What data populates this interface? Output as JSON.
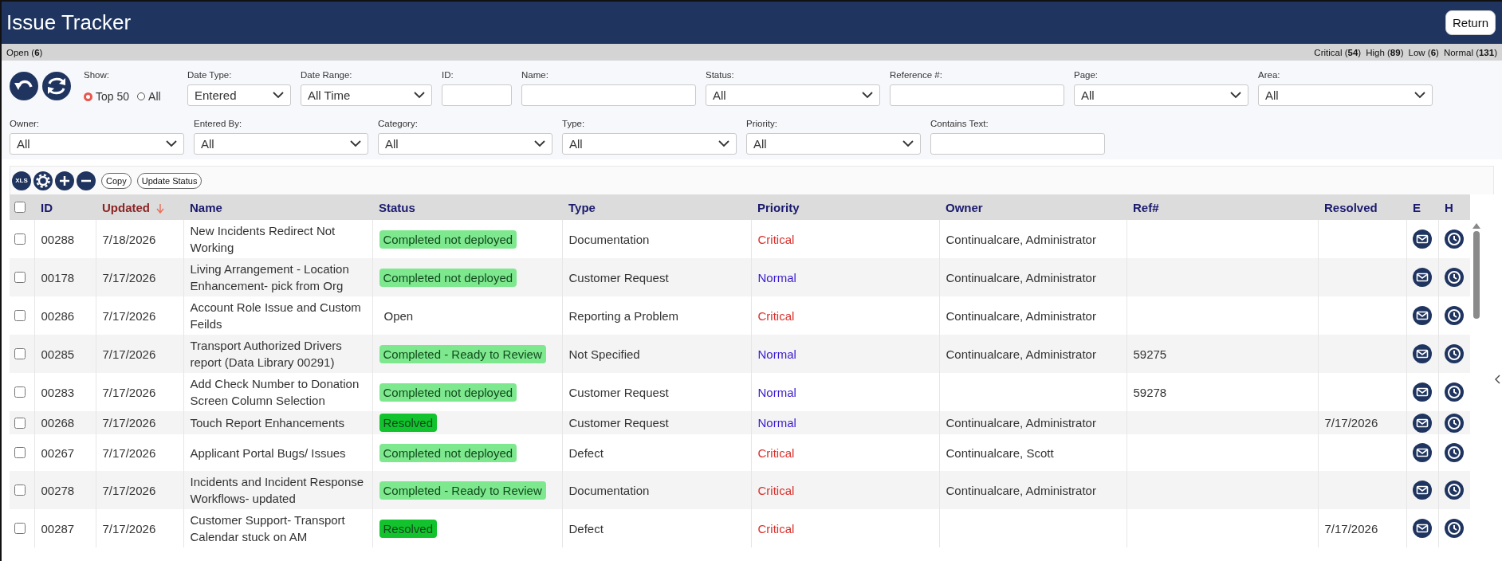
{
  "window": {
    "title": "Issue Tracker",
    "return_button": "Return"
  },
  "summary": {
    "open": "Open (**6**)",
    "counts": [
      "Critical (**54**)",
      "High (**89**)",
      "Low (**6**)",
      "Normal (**131**)"
    ]
  },
  "filters": {
    "actions": [
      {
        "kind": "undo"
      },
      {
        "kind": "refresh"
      }
    ],
    "show": {
      "label": "Show:",
      "options": [
        {
          "label": "Top 50",
          "selected": true
        },
        {
          "label": "All",
          "selected": false
        }
      ]
    },
    "row_1": [
      {
        "label": "Date Type:",
        "kind": "select",
        "value": "Entered"
      },
      {
        "label": "Date Range:",
        "kind": "select",
        "value": "All Time"
      },
      {
        "label": "ID:",
        "kind": "text"
      },
      {
        "label": "Name:",
        "kind": "text"
      },
      {
        "label": "Status:",
        "kind": "select",
        "value": "All"
      },
      {
        "label": "Reference #:",
        "kind": "text"
      },
      {
        "label": "Page:",
        "kind": "select",
        "value": "All"
      },
      {
        "label": "Area:",
        "kind": "select",
        "value": "All"
      }
    ],
    "row_2": [
      {
        "label": "Owner:",
        "kind": "select",
        "value": "All"
      },
      {
        "label": "Entered By:",
        "kind": "select",
        "value": "All"
      },
      {
        "label": "Category:",
        "kind": "select",
        "value": "All"
      },
      {
        "label": "Type:",
        "kind": "select",
        "value": "All"
      },
      {
        "label": "Priority:",
        "kind": "select",
        "value": "All"
      },
      {
        "label": "Contains Text:",
        "kind": "text"
      }
    ]
  },
  "toolbar": [
    {
      "kind": "xls",
      "label": "XLS"
    },
    {
      "kind": "gear"
    },
    {
      "kind": "plus"
    },
    {
      "kind": "minus"
    },
    {
      "kind": "text",
      "label": "Copy"
    },
    {
      "kind": "text",
      "label": "Update Status"
    }
  ],
  "table": {
    "select_all": {
      "checked": false
    },
    "columns": [
      {
        "label": "ID",
        "sorted": false
      },
      {
        "label": "Updated",
        "sorted": true
      },
      {
        "label": "Name",
        "sorted": false
      },
      {
        "label": "Status",
        "sorted": false
      },
      {
        "label": "Type",
        "sorted": false
      },
      {
        "label": "Priority",
        "sorted": false
      },
      {
        "label": "Owner",
        "sorted": false
      },
      {
        "label": "Ref#",
        "sorted": false
      },
      {
        "label": "Resolved",
        "sorted": false
      },
      {
        "label": "E",
        "sorted": false
      },
      {
        "label": "H",
        "sorted": false
      }
    ],
    "rows": [
      {
        "checked": false,
        "id": "00288",
        "updated": "7/18/2026",
        "name": "New Incidents Redirect Not Working",
        "status": {
          "text": "Completed not deployed",
          "color": "#7ee88f"
        },
        "type": "Documentation",
        "priority": {
          "text": "Critical",
          "color": "#d9302c"
        },
        "owner": "Continualcare, Administrator"
      },
      {
        "checked": false,
        "id": "00178",
        "updated": "7/17/2026",
        "name": "Living Arrangement - Location Enhancement- pick from Org",
        "status": {
          "text": "Completed not deployed",
          "color": "#7ee88f"
        },
        "type": "Customer Request",
        "priority": {
          "text": "Normal",
          "color": "#3a1ad0"
        },
        "owner": "Continualcare, Administrator"
      },
      {
        "checked": false,
        "id": "00286",
        "updated": "7/17/2026",
        "name": "Account Role Issue and Custom Feilds",
        "status": {
          "text": "Open"
        },
        "type": "Reporting a Problem",
        "priority": {
          "text": "Critical",
          "color": "#d9302c"
        },
        "owner": "Continualcare, Administrator"
      },
      {
        "checked": false,
        "id": "00285",
        "updated": "7/17/2026",
        "name": "Transport Authorized Drivers report (Data Library 00291)",
        "status": {
          "text": "Completed - Ready to Review",
          "color": "#7ee88f"
        },
        "type": "Not Specified",
        "priority": {
          "text": "Normal",
          "color": "#3a1ad0"
        },
        "owner": "Continualcare, Administrator",
        "ref": "59275"
      },
      {
        "checked": false,
        "id": "00283",
        "updated": "7/17/2026",
        "name": "Add Check Number to Donation Screen Column Selection",
        "status": {
          "text": "Completed not deployed",
          "color": "#7ee88f"
        },
        "type": "Customer Request",
        "priority": {
          "text": "Normal",
          "color": "#3a1ad0"
        },
        "ref": "59278"
      },
      {
        "checked": false,
        "id": "00268",
        "updated": "7/17/2026",
        "name": "Touch Report Enhancements",
        "status": {
          "text": "Resolved",
          "color": "#12c32e"
        },
        "type": "Customer Request",
        "priority": {
          "text": "Normal",
          "color": "#3a1ad0"
        },
        "owner": "Continualcare, Administrator",
        "resolved": "7/17/2026"
      },
      {
        "checked": false,
        "id": "00267",
        "updated": "7/17/2026",
        "name": "Applicant Portal Bugs/ Issues",
        "status": {
          "text": "Completed not deployed",
          "color": "#7ee88f"
        },
        "type": "Defect",
        "priority": {
          "text": "Critical",
          "color": "#d9302c"
        },
        "owner": "Continualcare, Scott"
      },
      {
        "checked": false,
        "id": "00278",
        "updated": "7/17/2026",
        "name": "Incidents and Incident Response Workflows- updated",
        "status": {
          "text": "Completed - Ready to Review",
          "color": "#7ee88f"
        },
        "type": "Documentation",
        "priority": {
          "text": "Critical",
          "color": "#d9302c"
        },
        "owner": "Continualcare, Administrator"
      },
      {
        "checked": false,
        "id": "00287",
        "updated": "7/17/2026",
        "name": "Customer Support- Transport Calendar stuck on AM",
        "status": {
          "text": "Resolved",
          "color": "#12c32e"
        },
        "type": "Defect",
        "priority": {
          "text": "Critical",
          "color": "#d9302c"
        },
        "resolved": "7/17/2026"
      }
    ]
  }
}
